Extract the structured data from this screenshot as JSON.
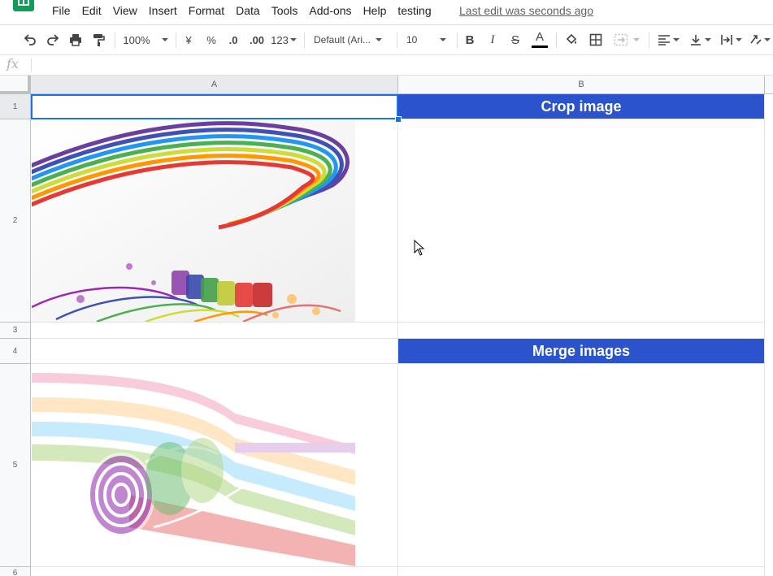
{
  "menu": {
    "items": [
      "File",
      "Edit",
      "View",
      "Insert",
      "Format",
      "Data",
      "Tools",
      "Add-ons",
      "Help",
      "testing"
    ],
    "last_edit": "Last edit was seconds ago"
  },
  "toolbar": {
    "zoom": "100%",
    "currency": "¥",
    "percent": "%",
    "decrease_decimal": ".0",
    "increase_decimal": ".00",
    "more_formats": "123",
    "font": "Default (Ari...",
    "font_size": "10",
    "bold": "B",
    "italic": "I",
    "strikethrough": "S",
    "text_color": "A"
  },
  "formula_bar": {
    "fx": "fx",
    "value": ""
  },
  "columns": [
    "A",
    "B"
  ],
  "rows": [
    "1",
    "2",
    "3",
    "4",
    "5",
    "6"
  ],
  "cells": {
    "B1": "Crop image",
    "B4": "Merge images"
  },
  "colors": {
    "header_fill": "#2a53cc",
    "selection": "#1a73e8",
    "sheets_green": "#0f9d58"
  },
  "images": [
    {
      "cell": "A2",
      "subject": "rainbow-paint-bottles-ribbons"
    },
    {
      "cell": "A5",
      "subject": "rainbow-rolled-ribbons"
    }
  ]
}
